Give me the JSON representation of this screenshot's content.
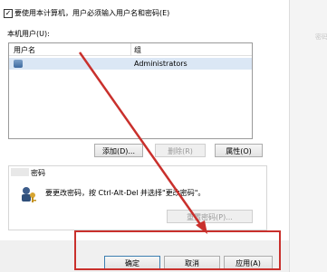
{
  "dialog": {
    "require_checkbox": {
      "checked": true,
      "label": "要使用本计算机，用户必须输入用户名和密码(E)"
    },
    "users_label": "本机用户(U):",
    "user_list": {
      "columns": [
        "用户名",
        "组"
      ],
      "rows": [
        {
          "user": "",
          "group": "Administrators"
        }
      ]
    },
    "buttons": {
      "add": "添加(D)...",
      "remove": "删除(R)",
      "properties": "属性(O)"
    },
    "password_section": {
      "title": "密码",
      "text": "要更改密码，按 Ctrl-Alt-Del 并选择\"更改密码\"。",
      "reset_button": "重置密码(P)..."
    },
    "footer": {
      "ok": "确定",
      "cancel": "取消",
      "apply": "应用(A)"
    }
  },
  "side_hint": "密码",
  "colors": {
    "highlight": "#c9302c",
    "selection": "#dbe7f5"
  }
}
